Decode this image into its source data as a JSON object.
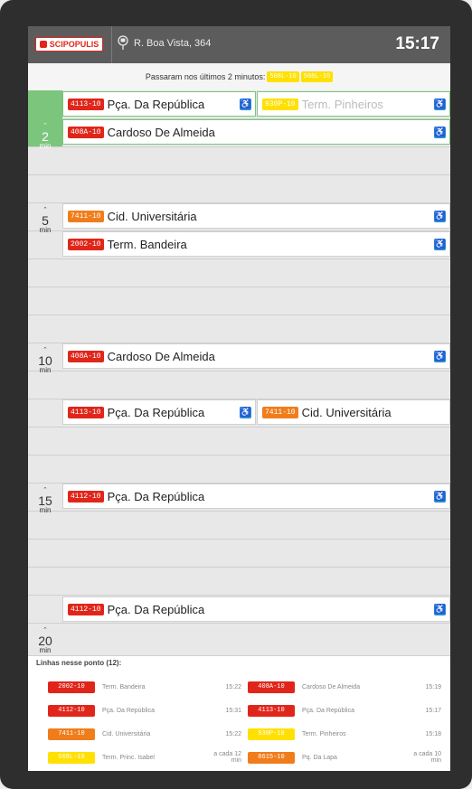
{
  "colors": {
    "red": "#e0261a",
    "orange": "#f07d1b",
    "yellow": "#ffe000",
    "green": "#7cc57c",
    "accessibility": "#2a8ad8",
    "header": "#5c5c5c"
  },
  "header": {
    "brand": "SCIPOPULIS",
    "stop_icon": "bus-stop-icon",
    "stop_name": "R. Boa Vista, 364",
    "clock": "15:17"
  },
  "passed": {
    "label": "Passaram nos últimos 2 minutos:",
    "badges": [
      "508L-10",
      "508L-10"
    ]
  },
  "ticks": [
    {
      "caret": "ˆ",
      "value": "2",
      "unit": "min"
    },
    {
      "caret": "ˆ",
      "value": "5",
      "unit": "min"
    },
    {
      "caret": "ˆ",
      "value": "10",
      "unit": "min"
    },
    {
      "caret": "ˆ",
      "value": "15",
      "unit": "min"
    },
    {
      "caret": "ˆ",
      "value": "20",
      "unit": "min"
    }
  ],
  "arrivals": [
    {
      "code": "4113-10",
      "dest": "Pça. Da República",
      "color": "red"
    },
    {
      "code": "930P-10",
      "dest": "Term. Pinheiros",
      "color": "yellow"
    },
    {
      "code": "408A-10",
      "dest": "Cardoso De Almeida",
      "color": "red"
    },
    {
      "code": "7411-10",
      "dest": "Cid. Universitária",
      "color": "orange"
    },
    {
      "code": "2002-10",
      "dest": "Term. Bandeira",
      "color": "red"
    },
    {
      "code": "408A-10",
      "dest": "Cardoso De Almeida",
      "color": "red"
    },
    {
      "code": "4113-10",
      "dest": "Pça. Da República",
      "color": "red"
    },
    {
      "code": "7411-10",
      "dest": "Cid. Universitária",
      "color": "orange"
    },
    {
      "code": "4112-10",
      "dest": "Pça. Da República",
      "color": "red"
    },
    {
      "code": "4112-10",
      "dest": "Pça. Da República",
      "color": "red"
    }
  ],
  "footer": {
    "title": "Linhas nesse ponto (12):",
    "rows": [
      {
        "code": "2002-10",
        "dest": "Term. Bandeira",
        "time": "15:22",
        "color": "red"
      },
      {
        "code": "408A-10",
        "dest": "Cardoso De Almeida",
        "time": "15:19",
        "color": "red"
      },
      {
        "code": "4112-10",
        "dest": "Pça. Da República",
        "time": "15:31",
        "color": "red"
      },
      {
        "code": "4113-10",
        "dest": "Pça. Da República",
        "time": "15:17",
        "color": "red"
      },
      {
        "code": "7411-10",
        "dest": "Cid. Universitária",
        "time": "15:22",
        "color": "orange"
      },
      {
        "code": "930P-10",
        "dest": "Term. Pinheiros",
        "time": "15:18",
        "color": "yellow"
      },
      {
        "code": "508L-10",
        "dest": "Term. Princ. Isabel",
        "time": "a cada 12 min",
        "color": "yellow"
      },
      {
        "code": "8615-10",
        "dest": "Pq. Da Lapa",
        "time": "a cada 10 min",
        "color": "orange"
      }
    ]
  }
}
